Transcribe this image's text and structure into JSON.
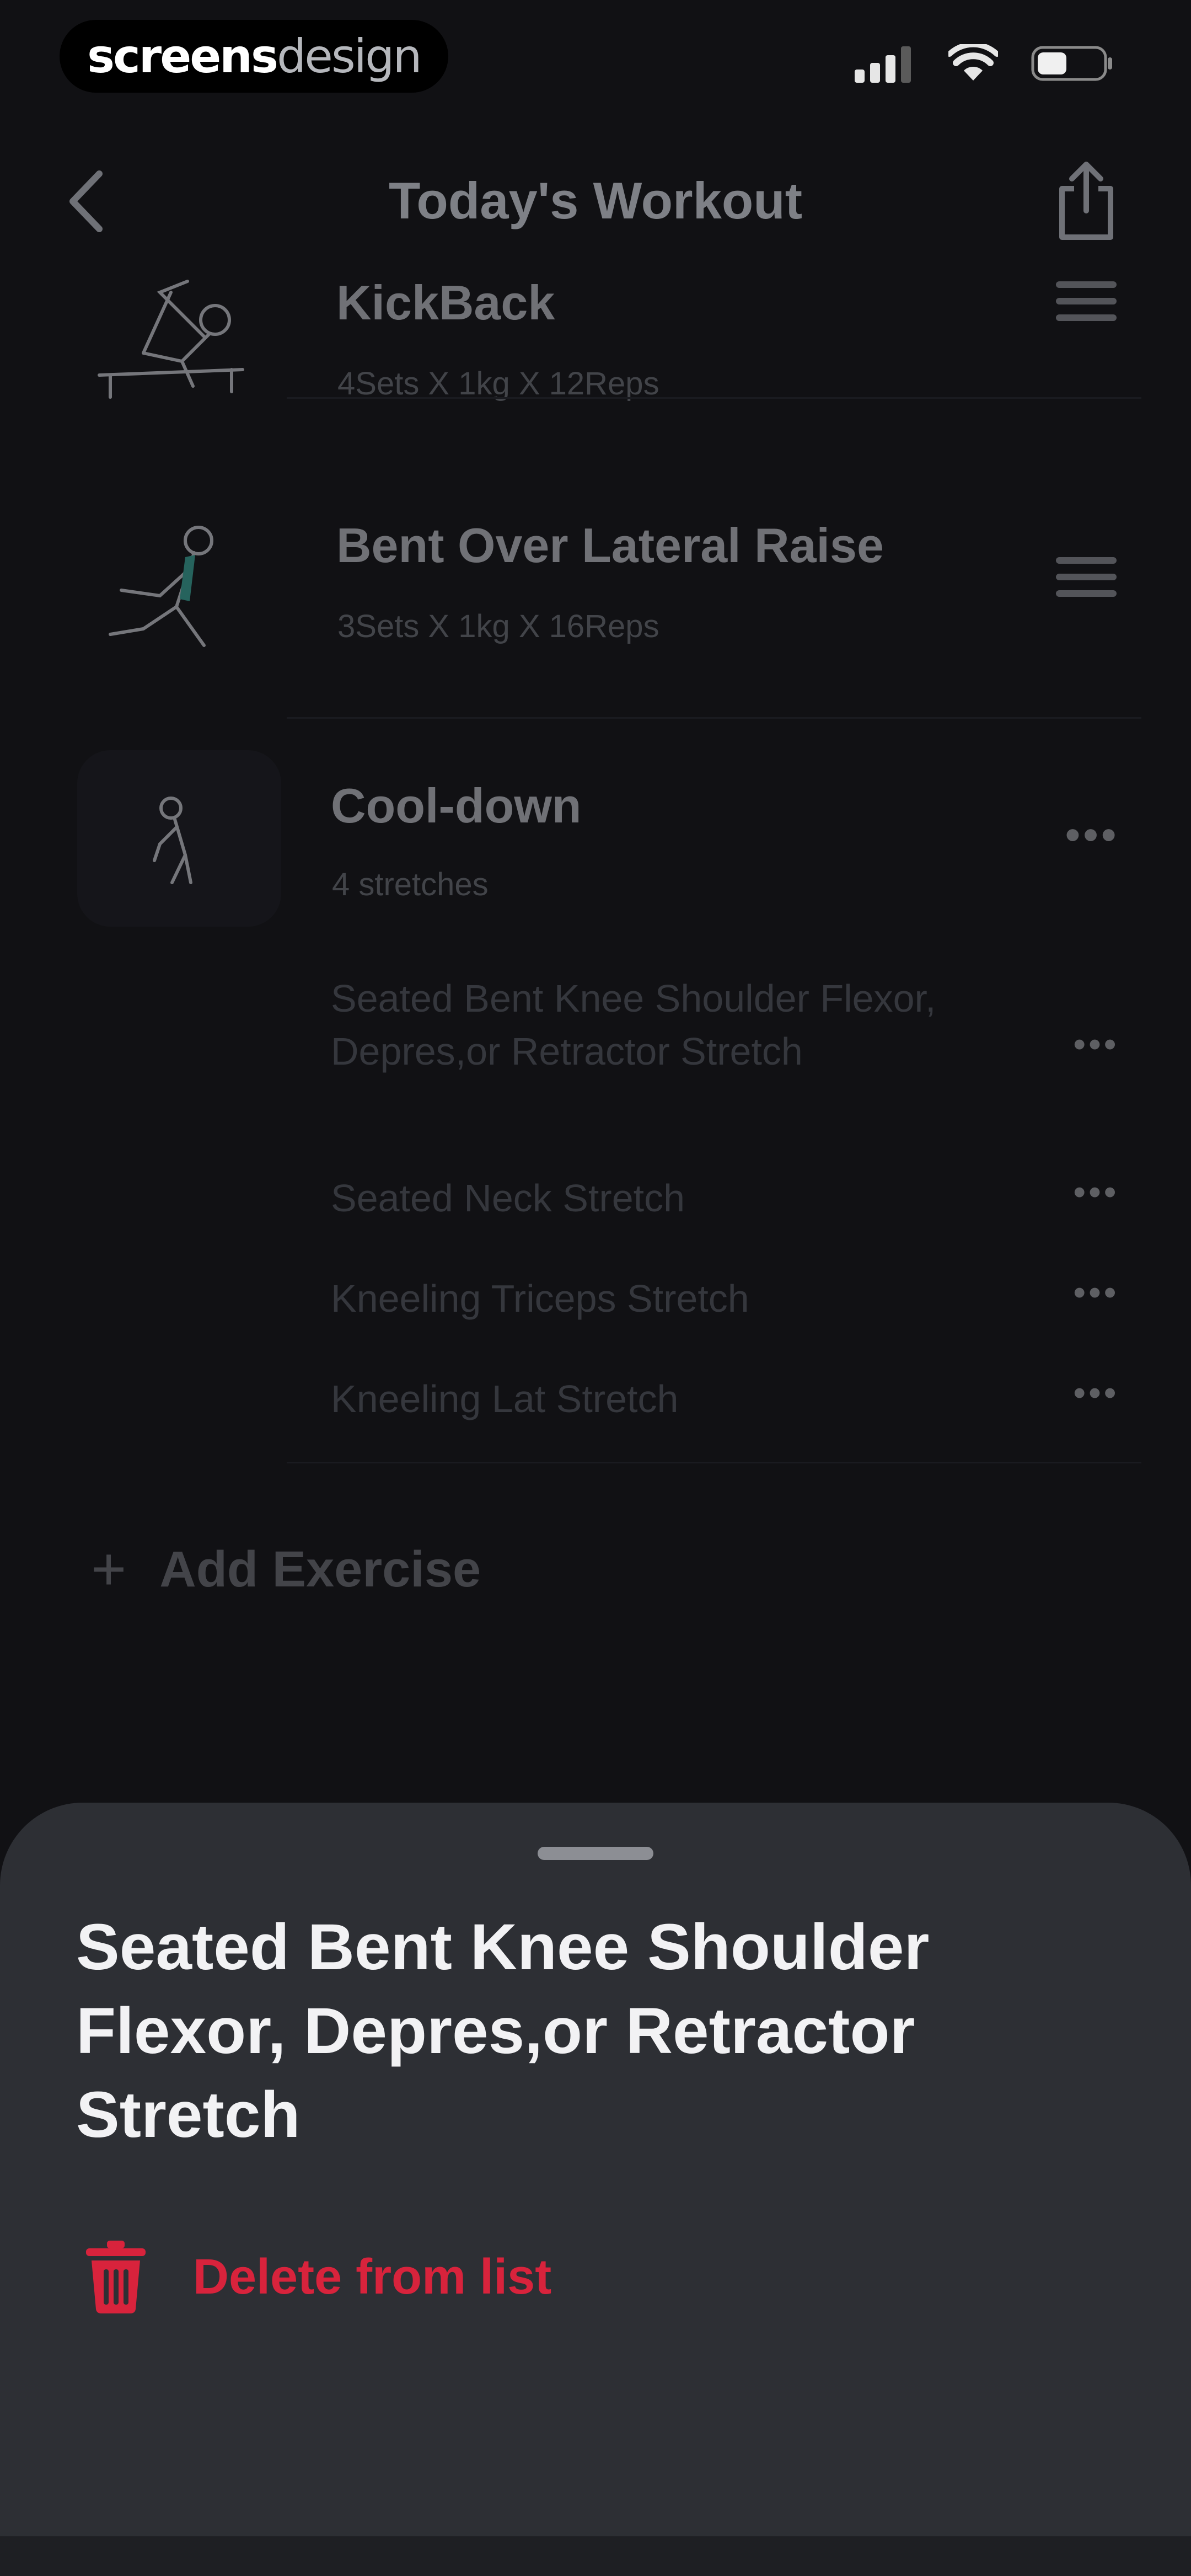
{
  "status_bar": {
    "watermark_bold": "screens",
    "watermark_light": "design"
  },
  "nav": {
    "title": "Today's Workout",
    "back_icon": "chevron-left-icon",
    "share_icon": "share-icon"
  },
  "exercises": [
    {
      "name": "KickBack",
      "details": "4Sets X 1kg X 12Reps"
    },
    {
      "name": "Bent Over Lateral Raise",
      "details": "3Sets X 1kg X 16Reps"
    }
  ],
  "cooldown": {
    "title": "Cool-down",
    "subtitle": "4 stretches",
    "stretches": [
      {
        "label": "Seated Bent Knee Shoulder Flexor, Depres,or Retractor Stretch"
      },
      {
        "label": "Seated Neck Stretch"
      },
      {
        "label": "Kneeling Triceps Stretch"
      },
      {
        "label": "Kneeling Lat Stretch"
      }
    ]
  },
  "add_exercise": {
    "label": "Add Exercise"
  },
  "sheet": {
    "title": "Seated Bent Knee Shoulder Flexor, Depres,or Retractor Stretch",
    "delete_label": "Delete from list"
  },
  "colors": {
    "background": "#111114",
    "sheet": "#2d2f34",
    "danger": "#d8233c"
  }
}
